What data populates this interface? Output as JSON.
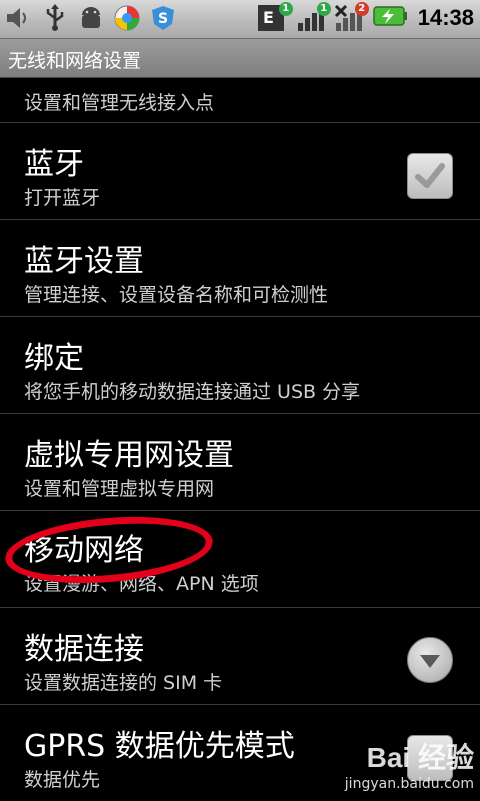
{
  "status_bar": {
    "icons_left": [
      "volume-icon",
      "usb-icon",
      "android-debug-icon",
      "browser-icon",
      "app-s-icon"
    ],
    "network_type": "E",
    "sim1_badge": "1",
    "sim2_badge": "1",
    "sim3_badge": "2",
    "time": "14:38"
  },
  "title_bar": {
    "title": "无线和网络设置"
  },
  "list": {
    "top_summary": "设置和管理无线接入点",
    "items": [
      {
        "title": "蓝牙",
        "summary": "打开蓝牙",
        "widget": "checkbox",
        "checked": true
      },
      {
        "title": "蓝牙设置",
        "summary": "管理连接、设置设备名称和可检测性"
      },
      {
        "title": "绑定",
        "summary": "将您手机的移动数据连接通过 USB 分享"
      },
      {
        "title": "虚拟专用网设置",
        "summary": "设置和管理虚拟专用网"
      },
      {
        "title": "移动网络",
        "summary": "设置漫游、网络、APN 选项"
      },
      {
        "title": "数据连接",
        "summary": "设置数据连接的 SIM 卡",
        "widget": "dropdown"
      },
      {
        "title": "GPRS 数据优先模式",
        "summary": "数据优先",
        "widget": "checkbox",
        "checked": false
      }
    ]
  },
  "watermark": {
    "logo": "Bai 经验",
    "url": "jingyan.baidu.com"
  },
  "colors": {
    "highlight": "#e3001b",
    "status_bg": "#c8c8c8",
    "title_bg": "#8c8c8c",
    "badge_green": "#2fa84a",
    "badge_red": "#d23a2a"
  }
}
